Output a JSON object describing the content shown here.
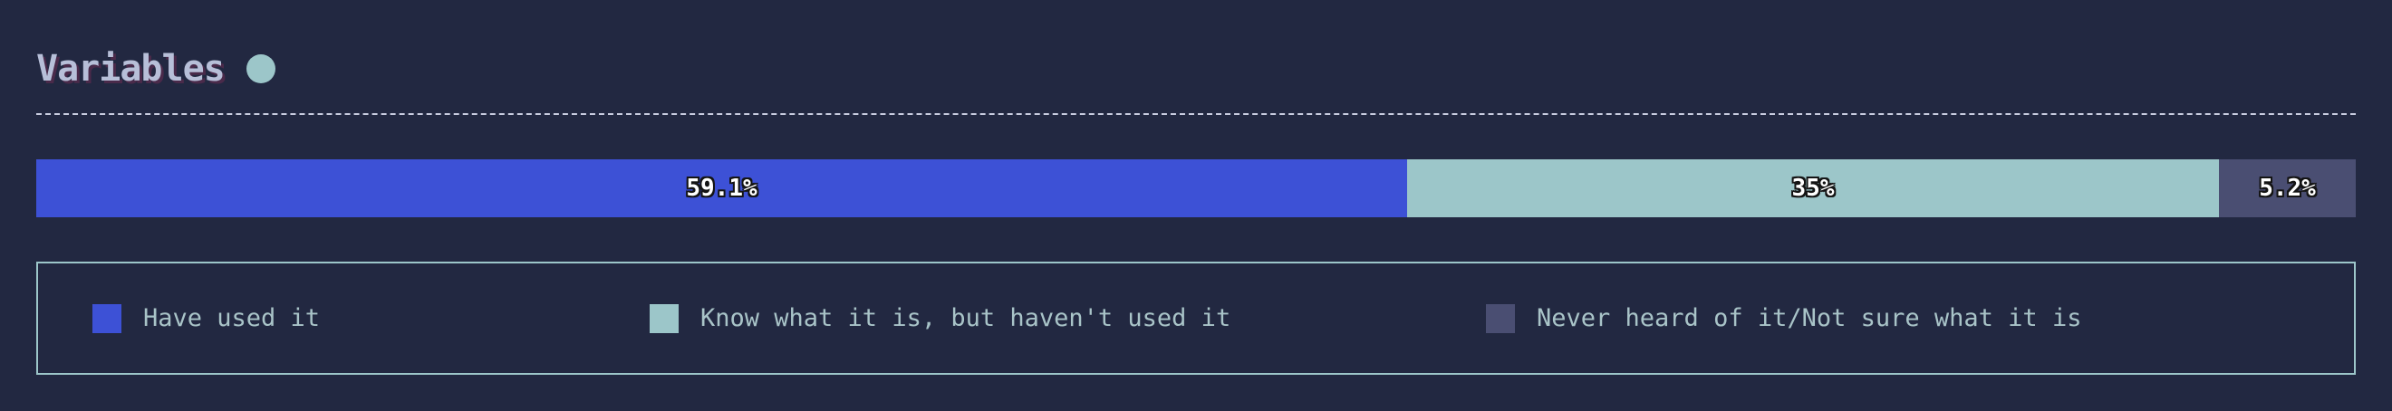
{
  "section": {
    "title": "Variables"
  },
  "colors": {
    "background": "#222841",
    "used": "#3d51d6",
    "know": "#9cc6c9",
    "never": "#4a4e72",
    "accent_dot": "#9cc6c9"
  },
  "chart_data": {
    "type": "bar",
    "orientation": "horizontal-stacked-100",
    "categories": [
      "Variables"
    ],
    "series": [
      {
        "name": "Have used it",
        "values": [
          59.1
        ],
        "label": "59.1%",
        "color": "#3d51d6"
      },
      {
        "name": "Know what it is, but haven't used it",
        "values": [
          35
        ],
        "label": "35%",
        "color": "#9cc6c9"
      },
      {
        "name": "Never heard of it/Not sure what it is",
        "values": [
          5.2
        ],
        "label": "5.2%",
        "color": "#4a4e72"
      }
    ],
    "xlim": [
      0,
      100
    ],
    "legend_position": "bottom"
  }
}
